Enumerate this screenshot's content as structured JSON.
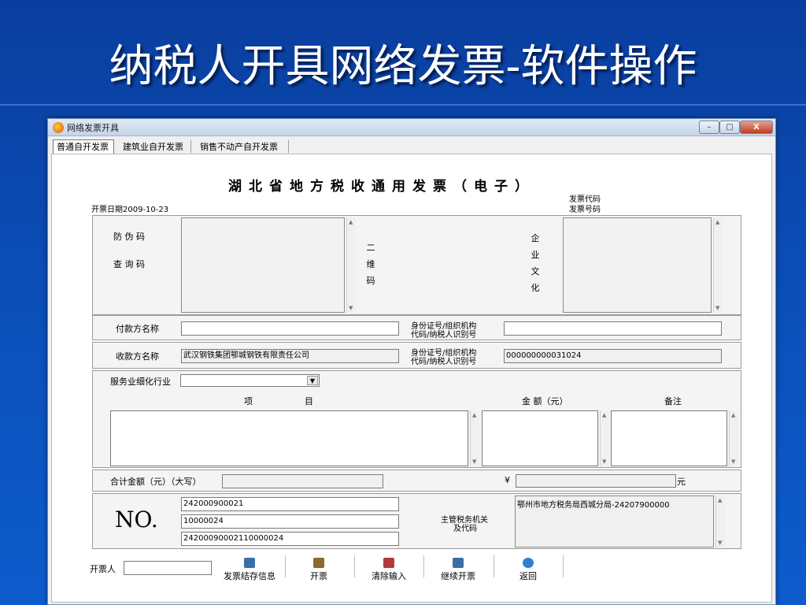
{
  "slide": {
    "title": "纳税人开具网络发票-软件操作"
  },
  "window": {
    "title": "网络发票开具",
    "min_label": "–",
    "max_label": "□",
    "close_label": "X"
  },
  "tabs": [
    {
      "label": "普通自开发票"
    },
    {
      "label": "建筑业自开发票"
    },
    {
      "label": "销售不动产自开发票"
    }
  ],
  "invoice": {
    "title": "湖北省地方税收通用发票（电子）",
    "date_label": "开票日期2009-10-23",
    "code_label": "发票代码",
    "number_label": "发票号码",
    "anti_fake_label": "防 伪 码",
    "query_label": "查 询 码",
    "qr_chars": [
      "二",
      "维",
      "码"
    ],
    "culture_chars": [
      "企",
      "业",
      "文",
      "化"
    ],
    "payer_label": "付款方名称",
    "payer_value": "",
    "id_label_1": "身份证号/组织机构",
    "id_label_2": "代码/纳税人识别号",
    "payer_id_value": "",
    "payee_label": "收款方名称",
    "payee_value": "武汉钢铁集团鄂城钢铁有限责任公司",
    "payee_id_value": "000000000031024",
    "industry_label": "服务业细化行业",
    "industry_value": "",
    "col_item": "项　　　　　　目",
    "col_amount": "金 额（元）",
    "col_note": "备注",
    "total_label": "合计金额（元）（大写）",
    "total_upper_value": "",
    "yen_symbol": "¥",
    "total_value": "",
    "yuan_label": "元",
    "no_label": "NO.",
    "no_values": [
      "242000900021",
      "10000024",
      "24200090002110000024"
    ],
    "tax_office_label_1": "主管税务机关",
    "tax_office_label_2": "及代码",
    "tax_office_value": "鄂州市地方税务局西城分局-24207900000"
  },
  "footer": {
    "issuer_label": "开票人",
    "issuer_value": "",
    "buttons": [
      {
        "label": "发票结存信息",
        "color": "#3a6ea5"
      },
      {
        "label": "开票",
        "color": "#8a6a2e"
      },
      {
        "label": "清除输入",
        "color": "#b23a3a"
      },
      {
        "label": "继续开票",
        "color": "#3a6ea5"
      },
      {
        "label": "返回",
        "color": "#2f7fd0"
      }
    ]
  }
}
